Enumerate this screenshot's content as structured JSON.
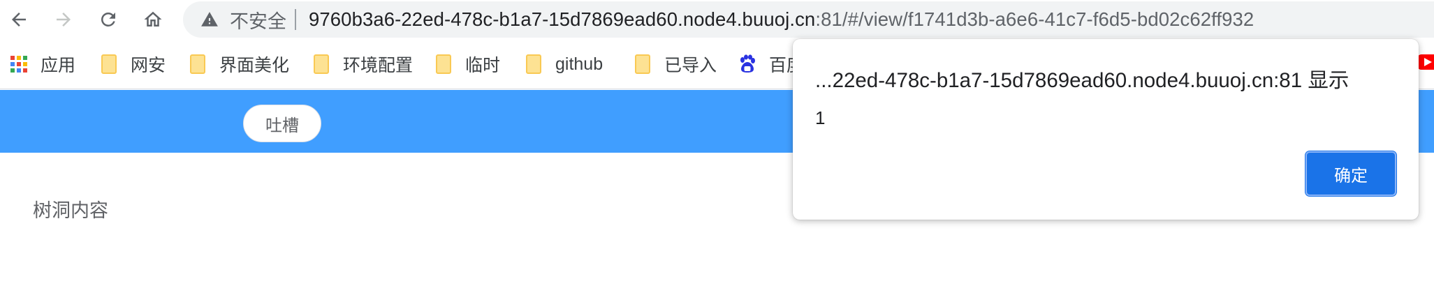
{
  "browser": {
    "omnibox": {
      "security_label": "不安全",
      "url_host": "9760b3a6-22ed-478c-b1a7-15d7869ead60.node4.buuoj.cn",
      "url_rest": ":81/#/view/f1741d3b-a6e6-41c7-f6d5-bd02c62ff932"
    },
    "icons": {
      "back": "back-arrow-icon",
      "forward": "forward-arrow-icon",
      "reload": "reload-icon",
      "home": "home-icon",
      "warning": "warning-triangle-icon"
    }
  },
  "bookmarks": [
    {
      "label": "应用",
      "icon": "apps-grid-icon"
    },
    {
      "label": "网安",
      "icon": "folder-icon"
    },
    {
      "label": "界面美化",
      "icon": "folder-icon"
    },
    {
      "label": "环境配置",
      "icon": "folder-icon"
    },
    {
      "label": "临时",
      "icon": "folder-icon"
    },
    {
      "label": "github",
      "icon": "folder-icon"
    },
    {
      "label": "已导入",
      "icon": "folder-icon"
    },
    {
      "label": "百度",
      "icon": "baidu-paw-icon"
    }
  ],
  "page": {
    "header_button": "吐槽",
    "body_text": "树洞内容",
    "header_color": "#409eff"
  },
  "dialog": {
    "title": "...22ed-478c-b1a7-15d7869ead60.node4.buuoj.cn:81 显示",
    "message": "1",
    "ok_label": "确定",
    "ok_color": "#1a73e8"
  }
}
